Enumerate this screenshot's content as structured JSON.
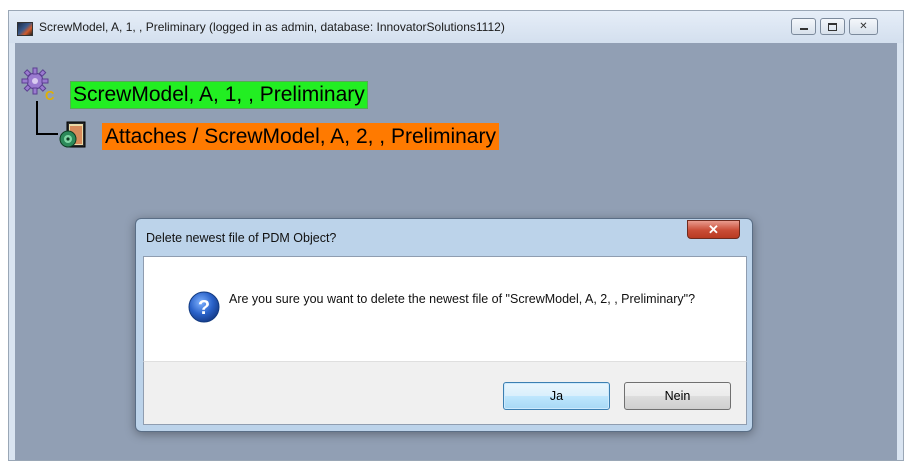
{
  "window": {
    "title": "ScrewModel, A, 1, , Preliminary (logged in as admin, database: InnovatorSolutions1112)",
    "minimize_icon": "minimize-icon",
    "maximize_icon": "maximize-icon",
    "close_icon": "close-icon",
    "close_glyph": "✕"
  },
  "tree": {
    "root": {
      "label": "ScrewModel, A, 1, , Preliminary",
      "icon": "product-gear-icon",
      "highlight_color": "#22ee22"
    },
    "child": {
      "label": "Attaches / ScrewModel, A, 2, , Preliminary",
      "icon": "document-attachment-icon",
      "highlight_color": "#ff7a00"
    }
  },
  "dialog": {
    "title": "Delete newest file of PDM Object?",
    "close_glyph": "✕",
    "icon": "question-icon",
    "question_glyph": "?",
    "message": "Are you sure you want to delete the newest file of \"ScrewModel, A, 2, , Preliminary\"?",
    "yes_label": "Ja",
    "no_label": "Nein"
  },
  "colors": {
    "canvas_background": "#919fb4",
    "root_highlight": "#22ee22",
    "child_highlight": "#ff7a00"
  }
}
